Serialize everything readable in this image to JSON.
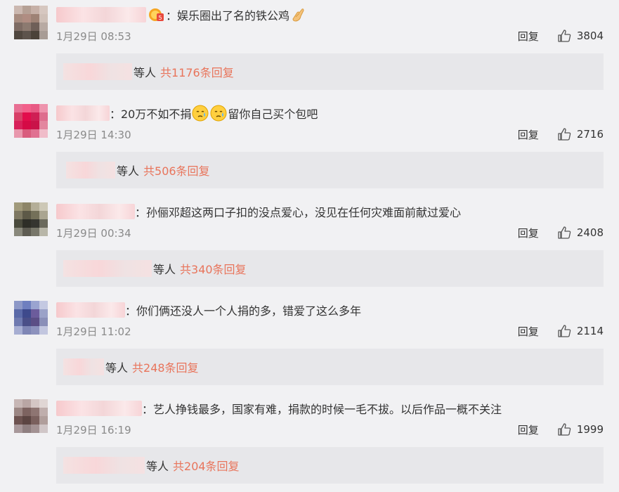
{
  "comments": [
    {
      "text": "：娱乐圈出了名的铁公鸡",
      "date": "1月29日 08:53",
      "reply_label": "回复",
      "likes": "3804",
      "sub": {
        "etc": "等人",
        "total": "共1176条回复"
      },
      "avatar_colors": [
        "#cbb8b0",
        "#b5a095",
        "#c6b0a7",
        "#d6c7c0",
        "#a78c80",
        "#b08d82",
        "#9e8275",
        "#cfc0b8",
        "#7e6c64",
        "#8c7a70",
        "#6f5f58",
        "#b8aaa3",
        "#50473f",
        "#5d534c",
        "#4b4239",
        "#a89c95"
      ]
    },
    {
      "text": "：20万不如不捐",
      "text2": "留你自己买个包吧",
      "date": "1月29日 14:30",
      "reply_label": "回复",
      "likes": "2716",
      "sub": {
        "etc": "等人",
        "total": "共506条回复"
      },
      "avatar_colors": [
        "#e86f93",
        "#f2608a",
        "#e85a84",
        "#ee94ad",
        "#d83f67",
        "#e20d4c",
        "#cf1f54",
        "#de6e8e",
        "#d8215a",
        "#d50a46",
        "#c91349",
        "#e3869f",
        "#e897ac",
        "#d95d7d",
        "#e07191",
        "#f0bcc9"
      ]
    },
    {
      "text": "：孙俪邓超这两口子扣的没点爱心，没见在任何灾难面前献过爱心",
      "date": "1月29日 00:34",
      "reply_label": "回复",
      "likes": "2408",
      "sub": {
        "etc": "等人",
        "total": "共340条回复"
      },
      "avatar_colors": [
        "#a19a7b",
        "#8d8568",
        "#b4ae98",
        "#cdc8b6",
        "#7e7862",
        "#5d5947",
        "#747059",
        "#aaa591",
        "#4a4a3c",
        "#2e2e27",
        "#353530",
        "#6b6a5d",
        "#89887b",
        "#5e5c52",
        "#78776a",
        "#b8b6a8"
      ]
    },
    {
      "text": "：你们俩还没人一个人捐的多，错爱了这么多年",
      "date": "1月29日 11:02",
      "reply_label": "回复",
      "likes": "2114",
      "sub": {
        "etc": "等人",
        "total": "共248条回复"
      },
      "avatar_colors": [
        "#8d98c7",
        "#6f7fbf",
        "#9aa4d0",
        "#c4c9e2",
        "#5b6aa8",
        "#3e4a8c",
        "#6c5c9c",
        "#9ba2c8",
        "#6f7ab0",
        "#4a4f88",
        "#5b4e85",
        "#8a8fb8",
        "#a7aed2",
        "#7f86b5",
        "#8d92bd",
        "#c2c6df"
      ]
    },
    {
      "text": "：艺人挣钱最多，国家有难，捐款的时候一毛不拔。以后作品一概不关注",
      "date": "1月29日 16:19",
      "reply_label": "回复",
      "likes": "1999",
      "sub": {
        "etc": "等人",
        "total": "共204条回复"
      },
      "avatar_colors": [
        "#c7b7b5",
        "#b9a6a4",
        "#d4c6c4",
        "#e0d6d4",
        "#9c8784",
        "#7d6360",
        "#8e7572",
        "#bfaeac",
        "#6d5350",
        "#5c4542",
        "#7a605d",
        "#b09e9b",
        "#a8989a",
        "#8f7f80",
        "#a39293",
        "#d0c6c7"
      ]
    }
  ]
}
